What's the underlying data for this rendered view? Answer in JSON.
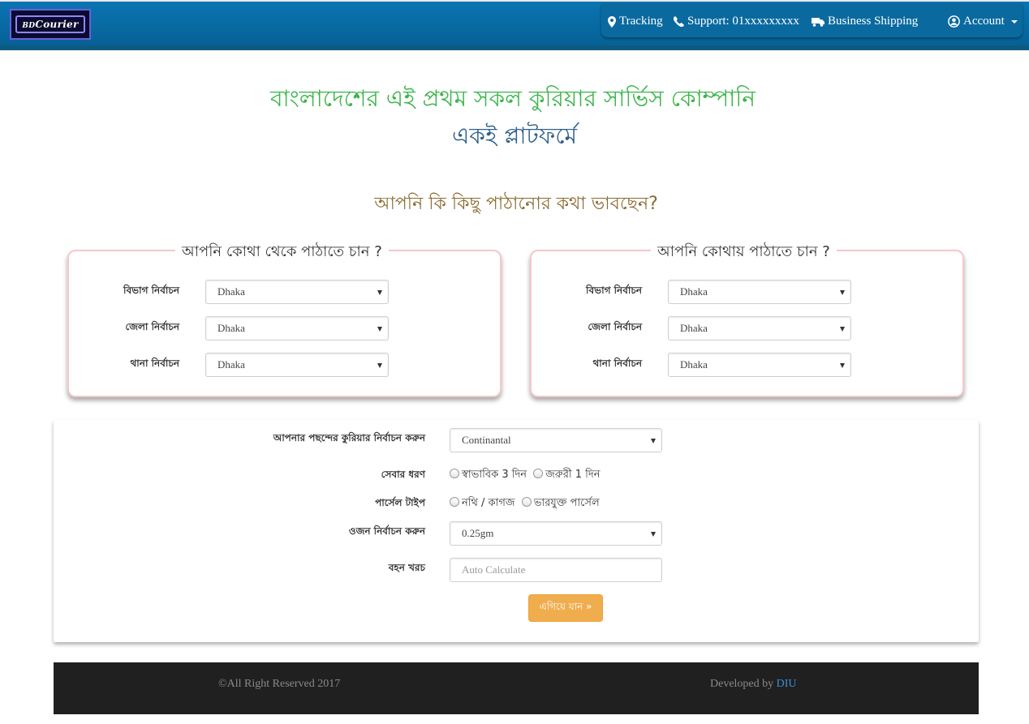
{
  "brand": {
    "logo_prefix": "BD",
    "logo_name": "Courier"
  },
  "nav": {
    "tracking": "Tracking",
    "support": "Support: 01xxxxxxxxx",
    "business": "Business Shipping",
    "account": "Account"
  },
  "hero": {
    "line1": "বাংলাদেশের এই প্রথম সকল কুরিয়ার সার্ভিস কোম্পানি",
    "line2": "একই প্লাটফর্মে"
  },
  "question": "আপনি কি কিছু পাঠানোর কথা ভাবছেন?",
  "from_panel": {
    "legend": "আপনি কোথা থেকে পাঠাতে চান ?",
    "division_label": "বিভাগ নির্বাচন",
    "division_value": "Dhaka",
    "district_label": "জেলা নির্বাচন",
    "district_value": "Dhaka",
    "thana_label": "থানা নির্বাচন",
    "thana_value": "Dhaka"
  },
  "to_panel": {
    "legend": "আপনি কোথায় পাঠাতে চান ?",
    "division_label": "বিভাগ নির্বাচন",
    "division_value": "Dhaka",
    "district_label": "জেলা নির্বাচন",
    "district_value": "Dhaka",
    "thana_label": "থানা নির্বাচন",
    "thana_value": "Dhaka"
  },
  "form": {
    "courier_label": "আপনার পছন্দের কুরিয়ার নির্বাচন করুন",
    "courier_value": "Continantal",
    "service_label": "সেবার ধরণ",
    "service_opt1": "স্বাভাবিক 3 দিন",
    "service_opt2": "জরুরী 1 দিন",
    "parcel_label": "পার্সেল টাইপ",
    "parcel_opt1": "নথি / কাগজ",
    "parcel_opt2": "ভারযুক্ত পার্সেল",
    "weight_label": "ওজন নির্বাচন করুন",
    "weight_value": "0.25gm",
    "cost_label": "বহন খরচ",
    "cost_placeholder": "Auto Calculate",
    "submit": "এগিয়ে যান »"
  },
  "footer": {
    "copyright": "©All Right Reserved 2017",
    "dev_prefix": "Developed by ",
    "dev_link": "DIU"
  }
}
